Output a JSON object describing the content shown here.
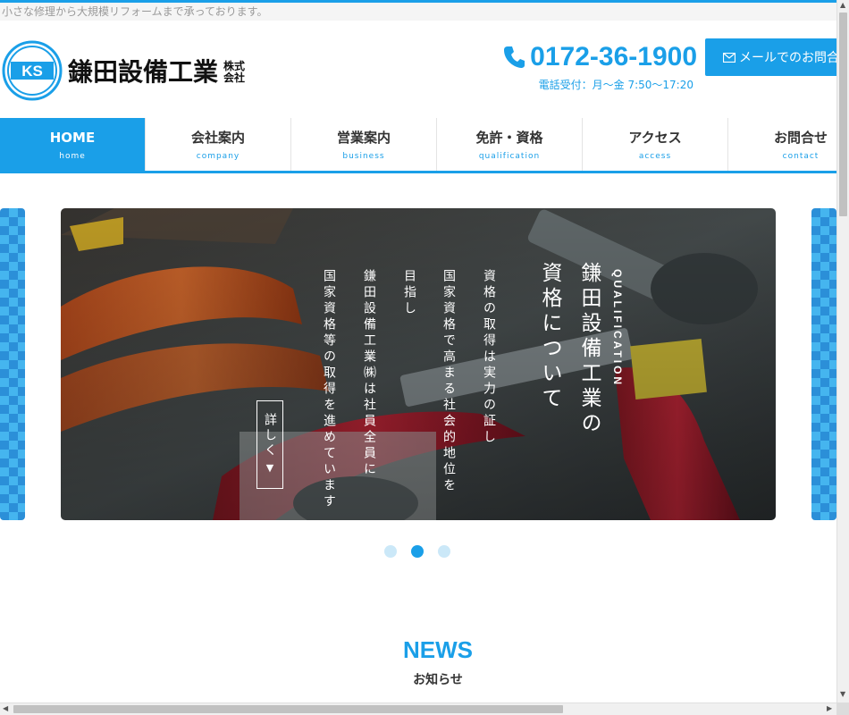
{
  "header": {
    "tagline": "小さな修理から大規模リフォームまで承っております。",
    "logo_mark": "KS",
    "logo_name": "鎌田設備工業",
    "logo_kk_top": "株式",
    "logo_kk_bottom": "会社",
    "phone": "0172-36-1900",
    "hours": "電話受付：月〜金 7:50〜17:20",
    "mail_button": "メールでのお問合せ"
  },
  "nav": {
    "items": [
      {
        "label": "HOME",
        "sub": "home",
        "active": true
      },
      {
        "label": "会社案内",
        "sub": "company"
      },
      {
        "label": "営業案内",
        "sub": "business"
      },
      {
        "label": "免許・資格",
        "sub": "qualification"
      },
      {
        "label": "アクセス",
        "sub": "access"
      },
      {
        "label": "お問合せ",
        "sub": "contact"
      }
    ]
  },
  "slider": {
    "en_label": "QUALIFICATION",
    "title_line1": "鎌田設備工業の",
    "title_line2": "資格について",
    "body": [
      "資格の取得は実力の証し",
      "国家資格で高まる社会的地位を",
      "目指し",
      "鎌田設備工業㈱は社員全員に",
      "国家資格等の取得を進めています"
    ],
    "more_label": "詳しく",
    "more_arrow": "▼",
    "active_slide": 2,
    "slide_count": 3
  },
  "news": {
    "title": "NEWS",
    "subtitle": "お知らせ"
  },
  "colors": {
    "accent": "#1a9fe8"
  },
  "icons": [
    "phone-icon",
    "mail-icon",
    "logo-mark"
  ]
}
